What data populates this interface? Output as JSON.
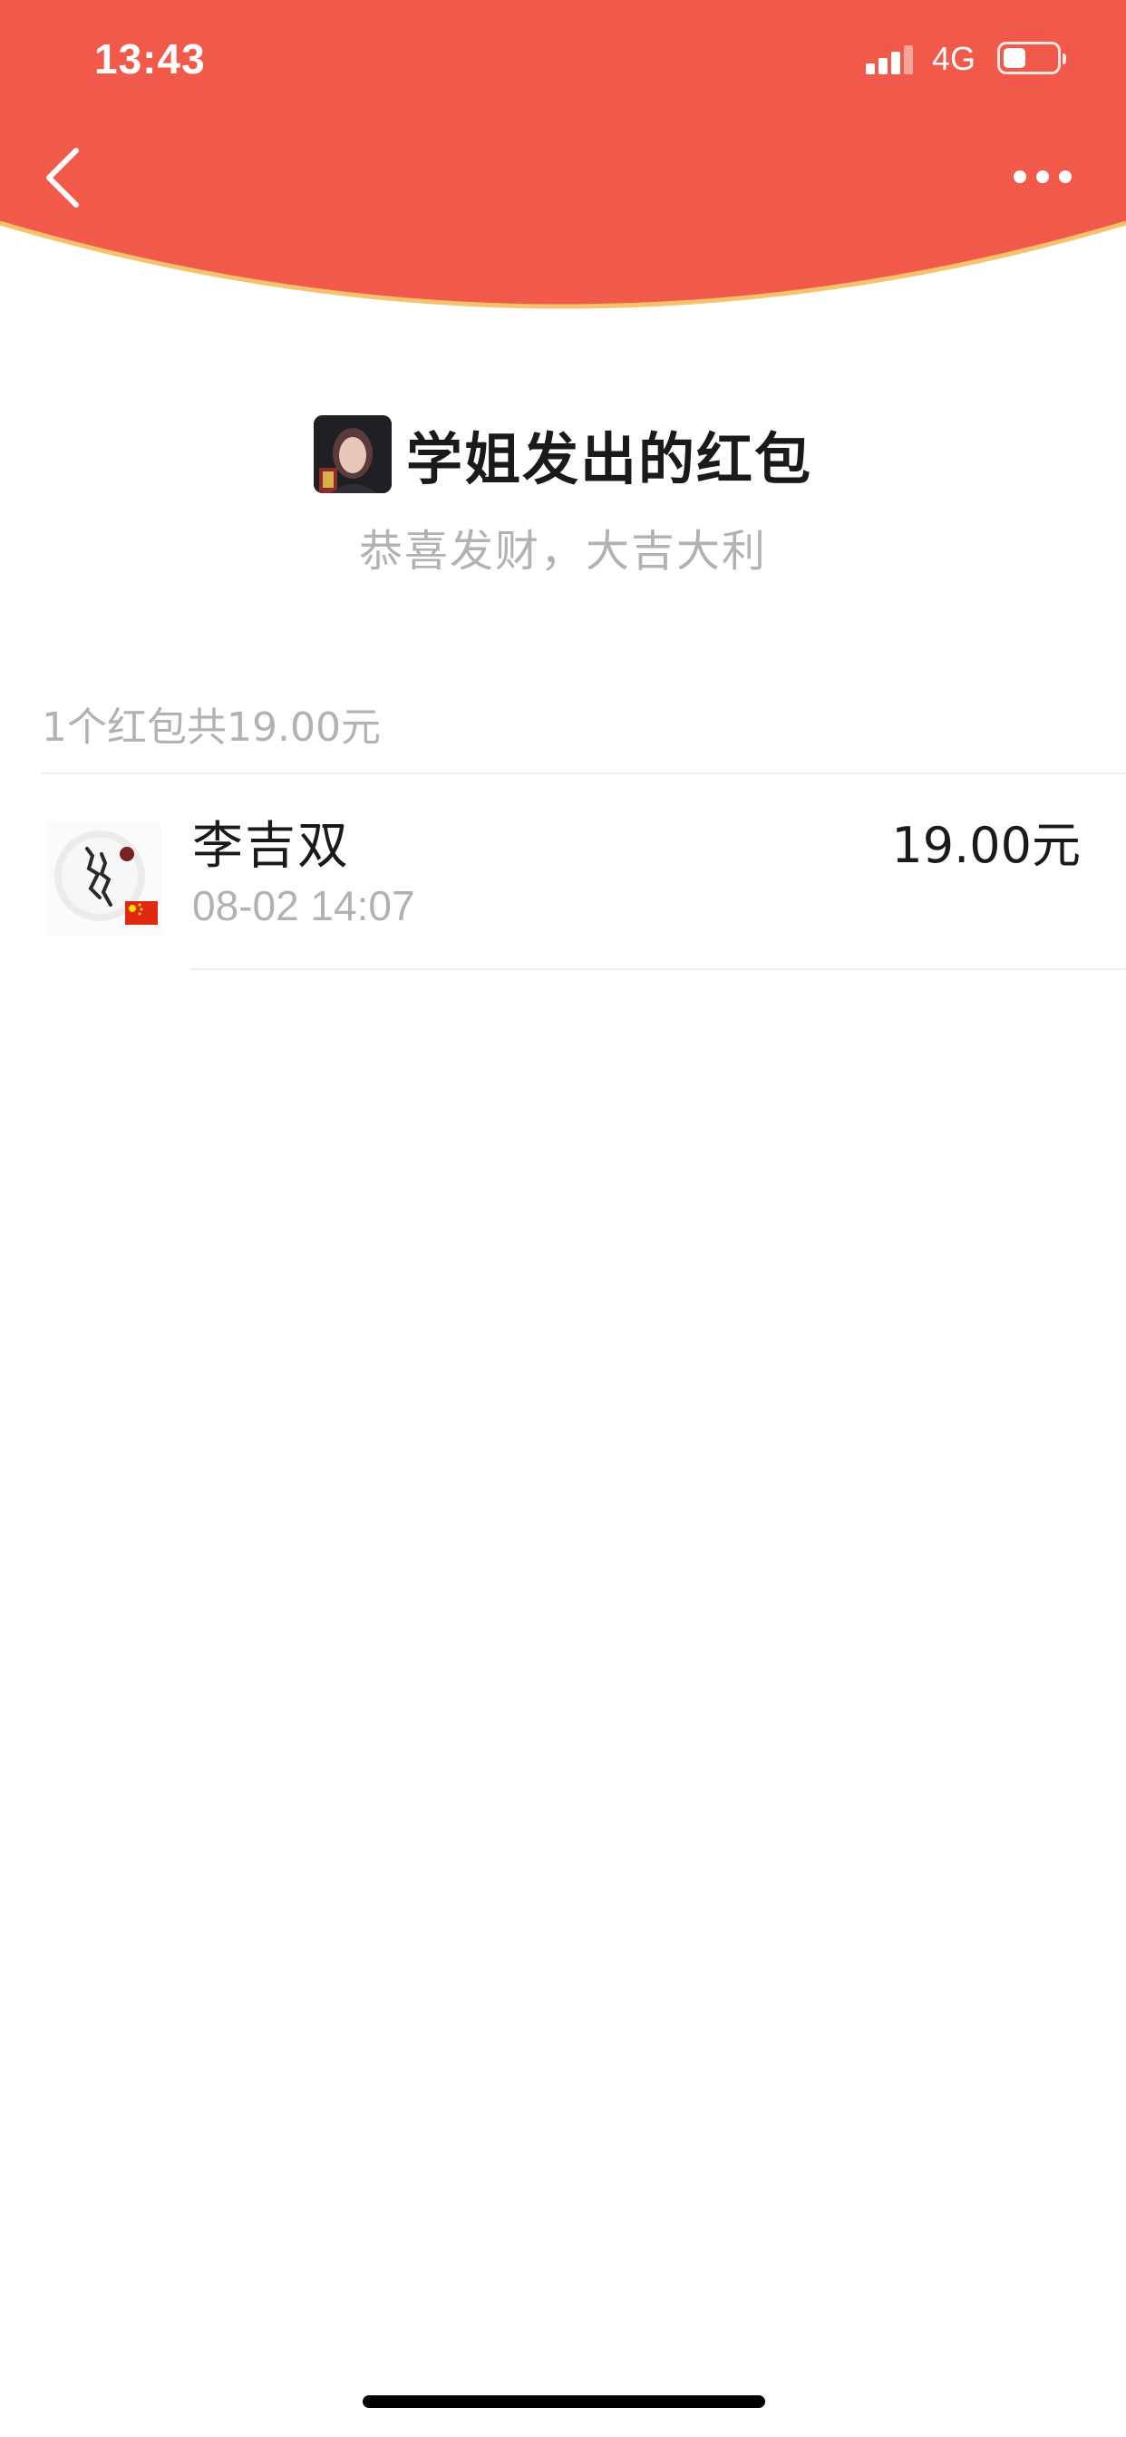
{
  "status_bar": {
    "time": "13:43",
    "network": "4G"
  },
  "header": {
    "background_color": "#F15A4A",
    "curve_edge_color": "#F6C26B"
  },
  "sender": {
    "title": "学姐发出的红包",
    "greeting": "恭喜发财，大吉大利"
  },
  "summary": {
    "text": "1个红包共19.00元"
  },
  "records": [
    {
      "name": "李吉双",
      "time": "08-02 14:07",
      "amount": "19.00元"
    }
  ],
  "icons": {
    "back": "chevron-left-icon",
    "more": "more-dots-icon",
    "flag": "china-flag-icon"
  }
}
